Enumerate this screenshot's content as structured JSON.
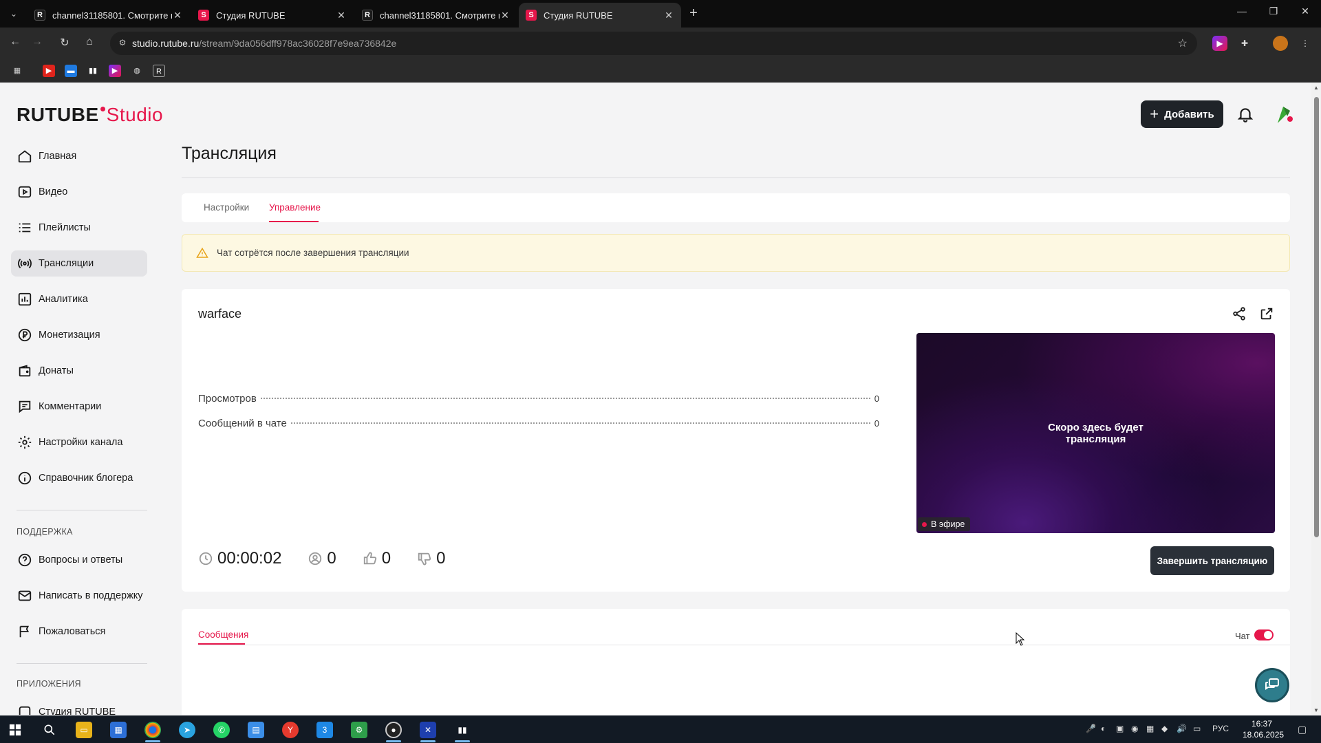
{
  "browser": {
    "tabs": [
      {
        "title": "channel31185801. Смотрите ві",
        "favicon": "R",
        "active": false
      },
      {
        "title": "Студия RUTUBE",
        "favicon": "S",
        "active": false
      },
      {
        "title": "channel31185801. Смотрите ві",
        "favicon": "R",
        "active": false
      },
      {
        "title": "Студия RUTUBE",
        "favicon": "S",
        "active": true
      }
    ],
    "url_host": "studio.rutube.ru",
    "url_path": "/stream/9da056dff978ac36028f7e9ea736842e"
  },
  "logo": {
    "part1": "RUTUBE",
    "part2": "Studio"
  },
  "header": {
    "add_label": "Добавить"
  },
  "sidebar": {
    "items": [
      {
        "label": "Главная",
        "icon": "home-icon"
      },
      {
        "label": "Видео",
        "icon": "video-icon"
      },
      {
        "label": "Плейлисты",
        "icon": "list-icon"
      },
      {
        "label": "Трансляции",
        "icon": "broadcast-icon",
        "active": true
      },
      {
        "label": "Аналитика",
        "icon": "chart-icon"
      },
      {
        "label": "Монетизация",
        "icon": "ruble-icon"
      },
      {
        "label": "Донаты",
        "icon": "wallet-icon"
      },
      {
        "label": "Комментарии",
        "icon": "comment-icon"
      },
      {
        "label": "Настройки канала",
        "icon": "gear-icon"
      },
      {
        "label": "Справочник блогера",
        "icon": "info-icon"
      }
    ],
    "support_heading": "ПОДДЕРЖКА",
    "support_items": [
      {
        "label": "Вопросы и ответы",
        "icon": "question-icon"
      },
      {
        "label": "Написать в поддержку",
        "icon": "mail-icon"
      },
      {
        "label": "Пожаловаться",
        "icon": "flag-icon"
      }
    ],
    "apps_heading": "ПРИЛОЖЕНИЯ",
    "apps_items": [
      {
        "label": "Студия RUTUBE"
      }
    ]
  },
  "main": {
    "title": "Трансляция",
    "tabs": [
      {
        "label": "Настройки"
      },
      {
        "label": "Управление",
        "active": true
      }
    ],
    "warning": "Чат сотрётся после завершения трансляции",
    "stream": {
      "name": "warface",
      "stats": [
        {
          "label": "Просмотров",
          "value": "0"
        },
        {
          "label": "Сообщений в чате",
          "value": "0"
        }
      ],
      "timer": "00:00:02",
      "viewers": "0",
      "likes": "0",
      "dislikes": "0",
      "player_message_line1": "Скоро здесь будет",
      "player_message_line2": "трансляция",
      "live_label": "В эфире",
      "end_button": "Завершить трансляцию"
    },
    "chat": {
      "tab_label": "Сообщения",
      "toggle_label": "Чат",
      "toggle_on": true
    }
  },
  "taskbar": {
    "lang": "РУС",
    "time": "16:37",
    "date": "18.06.2025"
  },
  "colors": {
    "accent": "#e6174b",
    "dark_button": "#1f2328",
    "warning_bg": "#fdf8e2"
  }
}
